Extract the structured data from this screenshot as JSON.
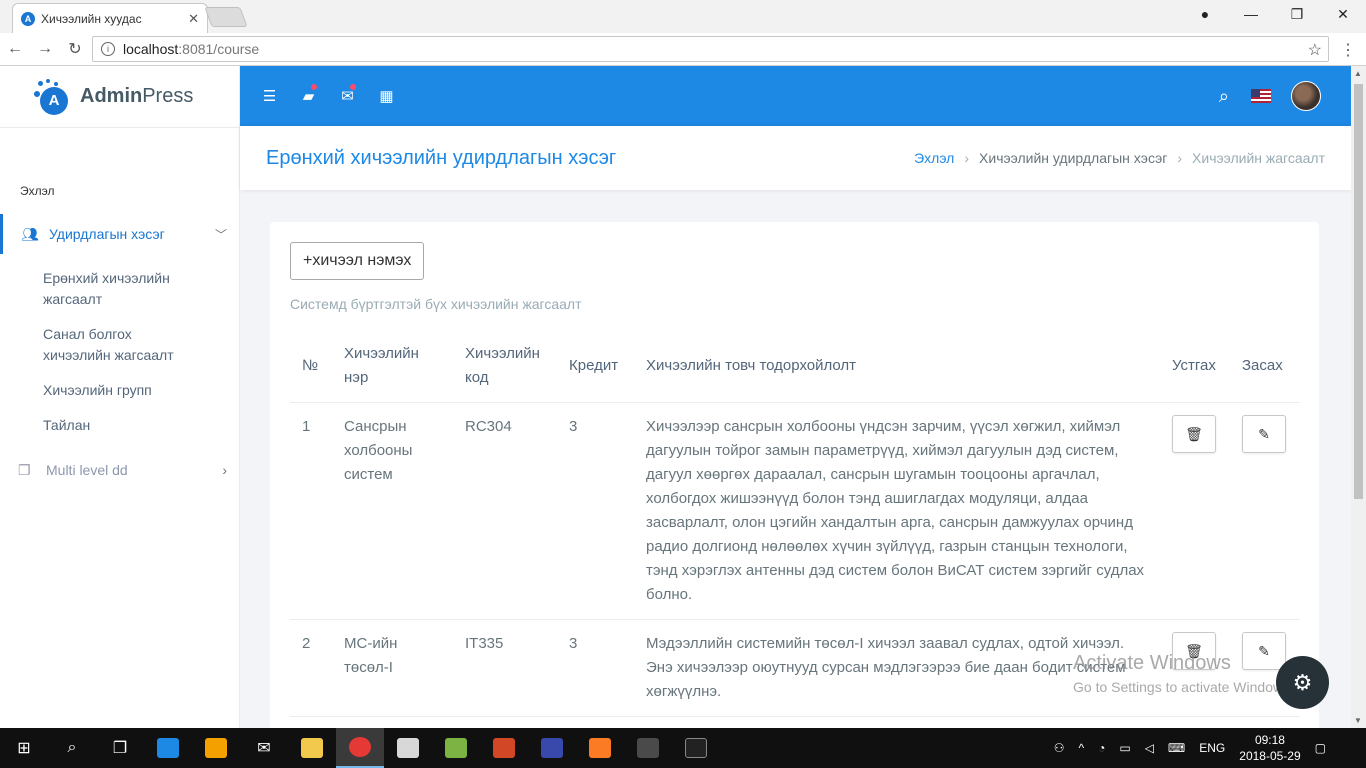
{
  "browser": {
    "tab_title": "Хичээлийн хуудас",
    "tab_favicon": "A",
    "url_host": "localhost",
    "url_path": ":8081/course"
  },
  "sidebar": {
    "logo_bold": "Admin",
    "logo_light": "Press",
    "logo_mark": "A",
    "section_label": "Эхлэл",
    "active_item": "Удирдлагын хэсэг",
    "sub_items": [
      "Ерөнхий хичээлийн жагсаалт",
      "Санал болгох хичээлийн жагсаалт",
      "Хичээлийн групп",
      "Тайлан"
    ],
    "multi_level": "Multi level dd"
  },
  "page": {
    "title": "Ерөнхий хичээлийн удирдлагын хэсэг",
    "breadcrumb": [
      "Эхлэл",
      "Хичээлийн удирдлагын хэсэг",
      "Хичээлийн жагсаалт"
    ]
  },
  "card": {
    "add_button": "хичээл нэмэх",
    "subtitle": "Системд бүртгэлтэй бүх хичээлийн жагсаалт",
    "columns": [
      "№",
      "Хичээлийн нэр",
      "Хичээлийн код",
      "Кредит",
      "Хичээлийн товч тодорхойлолт",
      "Устгах",
      "Засах"
    ],
    "rows": [
      {
        "no": "1",
        "name": "Сансрын холбооны систем",
        "code": "RC304",
        "credit": "3",
        "description": "Хичээлээр сансрын холбооны үндсэн зарчим, үүсэл хөгжил, хиймэл дагуулын тойрог замын параметрүүд, хиймэл дагуулын дэд систем, дагуул хөөргөх дараалал, сансрын шугамын тооцооны аргачлал, холбогдох жишээнүүд болон тэнд ашиглагдах модуляци, алдаа засварлалт, олон цэгийн хандалтын арга, сансрын дамжуулах орчинд радио долгионд нөлөөлөх хүчин зүйлүүд, газрын станцын технологи, тэнд хэрэглэх антенны дэд систем болон ВиСАТ систем зэргийг судлах болно."
      },
      {
        "no": "2",
        "name": "МС-ийн төсөл-I",
        "code": "IT335",
        "credit": "3",
        "description": "Мэдээллийн системийн төсөл-I хичээл заавал судлах, одтой хичээл. Энэ хичээлээр оюутнууд сурсан мэдлэгээрээ бие даан бодит систем хөгжүүлнэ."
      }
    ]
  },
  "watermark": {
    "line1": "Activate Windows",
    "line2": "Go to Settings to activate Windows."
  },
  "taskbar": {
    "lang": "ENG",
    "time": "09:18",
    "date": "2018-05-29"
  },
  "colors": {
    "primary": "#1e88e5",
    "topbar": "#1e88e5",
    "notify": "#fc4b6c"
  }
}
